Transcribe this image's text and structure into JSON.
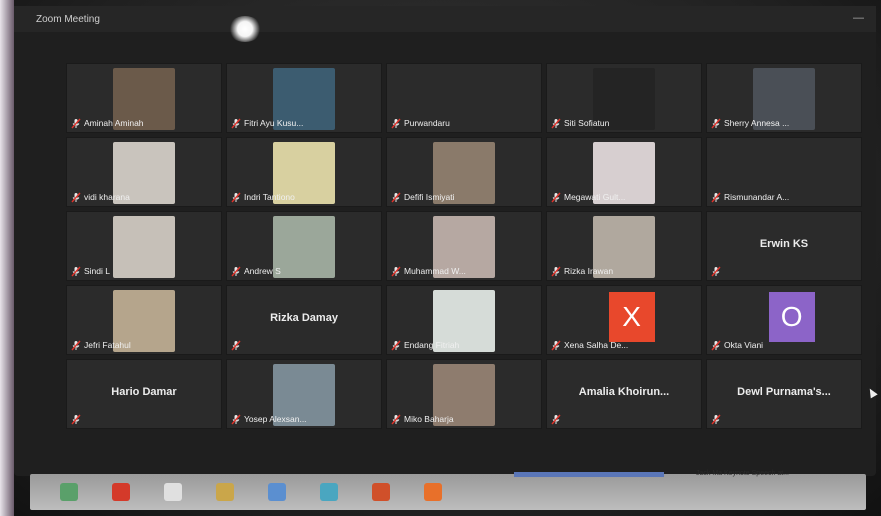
{
  "window": {
    "title": "Zoom Meeting",
    "minimize_glyph": "—"
  },
  "participants": [
    {
      "name": "Aminah Aminah",
      "bigname": "",
      "video": "#6b5a4a"
    },
    {
      "name": "Fitri Ayu Kusu...",
      "bigname": "",
      "video": "#3c5c70"
    },
    {
      "name": "Purwandaru",
      "bigname": "",
      "video": ""
    },
    {
      "name": "Siti Sofiatun",
      "bigname": "",
      "video": "#242424"
    },
    {
      "name": "Sherry Annesa ...",
      "bigname": "",
      "video": "#4a4f56"
    },
    {
      "name": "vidi kharana",
      "bigname": "",
      "video": "#c9c4bd"
    },
    {
      "name": "Indri Tantiono",
      "bigname": "",
      "video": "#d8d0a0"
    },
    {
      "name": "Defifi Ismiyati",
      "bigname": "",
      "video": "#8a7a6a"
    },
    {
      "name": "Megawati Gult...",
      "bigname": "",
      "video": "#d7cfd0"
    },
    {
      "name": "Rismunandar A...",
      "bigname": "",
      "video": ""
    },
    {
      "name": "Sindi L",
      "bigname": "",
      "video": "#c6c0b8"
    },
    {
      "name": "Andrew S",
      "bigname": "",
      "video": "#9ba79a"
    },
    {
      "name": "Muhammad W...",
      "bigname": "",
      "video": "#b6a8a2"
    },
    {
      "name": "Rizka Irawan",
      "bigname": "",
      "video": "#b0a89e"
    },
    {
      "name": "",
      "bigname": "Erwin KS",
      "video": ""
    },
    {
      "name": "Jefri Fatahul",
      "bigname": "",
      "video": "#b5a58c"
    },
    {
      "name": "",
      "bigname": "Rizka Damay",
      "video": ""
    },
    {
      "name": "Endang Fitriah",
      "bigname": "",
      "video": "#d6dcd8"
    },
    {
      "name": "Xena Salha De...",
      "bigname": "",
      "avatar": "X",
      "avatar_color": "#e8482c"
    },
    {
      "name": "Okta Viani",
      "bigname": "",
      "avatar": "O",
      "avatar_color": "#8c64c8"
    },
    {
      "name": "",
      "bigname": "Hario Damar",
      "video": ""
    },
    {
      "name": "Yosep Alexsan...",
      "bigname": "",
      "video": "#7a8a94"
    },
    {
      "name": "Miko Baharja",
      "bigname": "",
      "video": "#8e7c6e"
    },
    {
      "name": "",
      "bigname": "Amalia  Khoirun...",
      "video": ""
    },
    {
      "name": "",
      "bigname": "Dewl  Purnama's...",
      "video": ""
    }
  ],
  "taskbar": {
    "tooltip": "Jack Ma Keynote Speech at...",
    "icons": [
      "chrome-icon",
      "opera-icon",
      "file-icon",
      "folder-icon",
      "store-icon",
      "mail-icon",
      "ppt-icon",
      "browser-icon"
    ],
    "icon_colors": [
      "#5aa06a",
      "#d43a2a",
      "#e0e0e0",
      "#caa64a",
      "#5b8fd0",
      "#4aa6c0",
      "#d0502a",
      "#e8702a"
    ]
  }
}
